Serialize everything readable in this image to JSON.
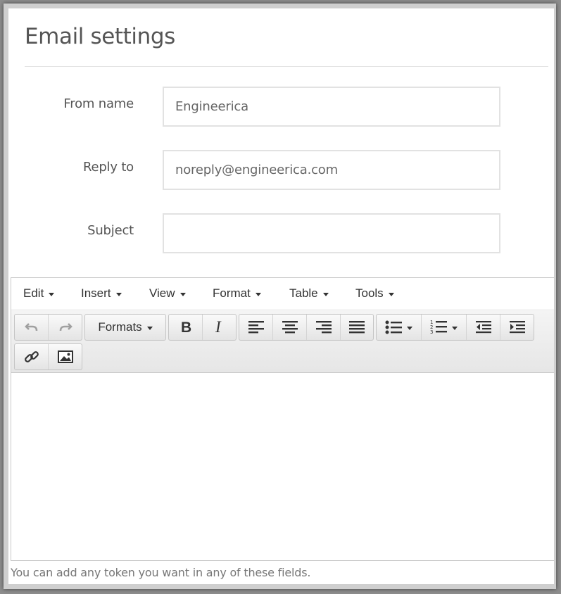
{
  "page": {
    "title": "Email settings"
  },
  "form": {
    "from_name": {
      "label": "From name",
      "value": "Engineerica"
    },
    "reply_to": {
      "label": "Reply to",
      "value": "noreply@engineerica.com"
    },
    "subject": {
      "label": "Subject",
      "value": ""
    }
  },
  "editor": {
    "menu": [
      "Edit",
      "Insert",
      "View",
      "Format",
      "Table",
      "Tools"
    ],
    "toolbar": {
      "formats_label": "Formats",
      "icons": [
        "undo-icon",
        "redo-icon",
        "bold-icon",
        "italic-icon",
        "align-left-icon",
        "align-center-icon",
        "align-right-icon",
        "align-justify-icon",
        "bullet-list-icon",
        "numbered-list-icon",
        "outdent-icon",
        "indent-icon",
        "link-icon",
        "image-icon"
      ]
    },
    "content": ""
  },
  "help_text": "You can add any token you want in any of these fields.",
  "colors": {
    "label": "#555555",
    "input_border": "#e2e2e2",
    "toolbar_bg": "#eeeeee",
    "disabled_icon": "#a0a0a0"
  }
}
